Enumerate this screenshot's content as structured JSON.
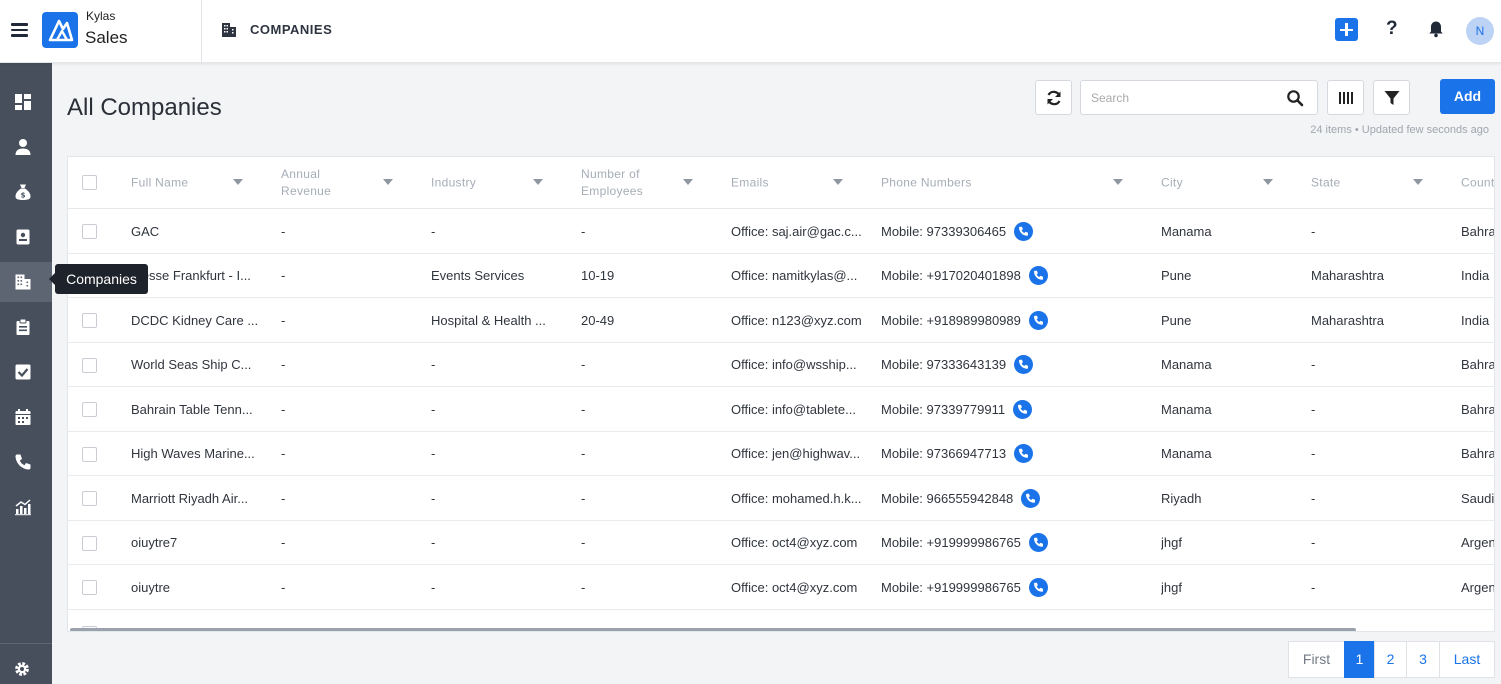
{
  "app": {
    "brand_top": "Kylas",
    "brand_bottom": "Sales",
    "module_title": "COMPANIES",
    "avatar_initial": "N",
    "help": "?"
  },
  "sidebar": {
    "items": [
      {
        "name": "dashboard-icon"
      },
      {
        "name": "contacts-icon"
      },
      {
        "name": "deals-icon"
      },
      {
        "name": "leads-icon"
      },
      {
        "name": "companies-icon",
        "active": true
      },
      {
        "name": "clipboard-icon"
      },
      {
        "name": "tasks-icon"
      },
      {
        "name": "calendar-icon"
      },
      {
        "name": "phone-icon"
      },
      {
        "name": "reports-icon"
      }
    ],
    "tooltip": "Companies"
  },
  "page": {
    "title": "All Companies"
  },
  "toolbar": {
    "search_placeholder": "Search",
    "add_label": "Add",
    "meta": "24 items • Updated few seconds ago"
  },
  "table": {
    "columns": [
      "Full Name",
      "Annual Revenue",
      "Industry",
      "Number of Employees",
      "Emails",
      "Phone Numbers",
      "City",
      "State",
      "Country"
    ],
    "rows": [
      {
        "name": "GAC",
        "revenue": "-",
        "industry": "-",
        "employees": "-",
        "email": "Office: saj.air@gac.c...",
        "phone": "Mobile: 97339306465",
        "city": "Manama",
        "state": "-",
        "country": "Bahra"
      },
      {
        "name": "Messe Frankfurt - I...",
        "revenue": "-",
        "industry": "Events Services",
        "employees": "10-19",
        "email": "Office: namitkylas@...",
        "phone": "Mobile: +917020401898",
        "city": "Pune",
        "state": "Maharashtra",
        "country": "India"
      },
      {
        "name": "DCDC Kidney Care ...",
        "revenue": "-",
        "industry": "Hospital & Health ...",
        "employees": "20-49",
        "email": "Office: n123@xyz.com",
        "phone": "Mobile: +918989980989",
        "city": "Pune",
        "state": "Maharashtra",
        "country": "India"
      },
      {
        "name": "World Seas Ship C...",
        "revenue": "-",
        "industry": "-",
        "employees": "-",
        "email": "Office: info@wsship...",
        "phone": "Mobile: 97333643139",
        "city": "Manama",
        "state": "-",
        "country": "Bahra"
      },
      {
        "name": "Bahrain Table Tenn...",
        "revenue": "-",
        "industry": "-",
        "employees": "-",
        "email": "Office: info@tablete...",
        "phone": "Mobile: 97339779911",
        "city": "Manama",
        "state": "-",
        "country": "Bahra"
      },
      {
        "name": "High Waves Marine...",
        "revenue": "-",
        "industry": "-",
        "employees": "-",
        "email": "Office: jen@highwav...",
        "phone": "Mobile: 97366947713",
        "city": "Manama",
        "state": "-",
        "country": "Bahra"
      },
      {
        "name": "Marriott Riyadh Air...",
        "revenue": "-",
        "industry": "-",
        "employees": "-",
        "email": "Office: mohamed.h.k...",
        "phone": "Mobile: 966555942848",
        "city": "Riyadh",
        "state": "-",
        "country": "Saudi"
      },
      {
        "name": "oiuytre7",
        "revenue": "-",
        "industry": "-",
        "employees": "-",
        "email": "Office: oct4@xyz.com",
        "phone": "Mobile: +919999986765",
        "city": "jhgf",
        "state": "-",
        "country": "Argen"
      },
      {
        "name": "oiuytre",
        "revenue": "-",
        "industry": "-",
        "employees": "-",
        "email": "Office: oct4@xyz.com",
        "phone": "Mobile: +919999986765",
        "city": "jhgf",
        "state": "-",
        "country": "Argen"
      }
    ]
  },
  "pagination": {
    "first": "First",
    "pages": [
      "1",
      "2",
      "3"
    ],
    "last": "Last",
    "current": "1"
  },
  "colors": {
    "accent": "#1a73e8",
    "sidebar": "#474f5c"
  }
}
